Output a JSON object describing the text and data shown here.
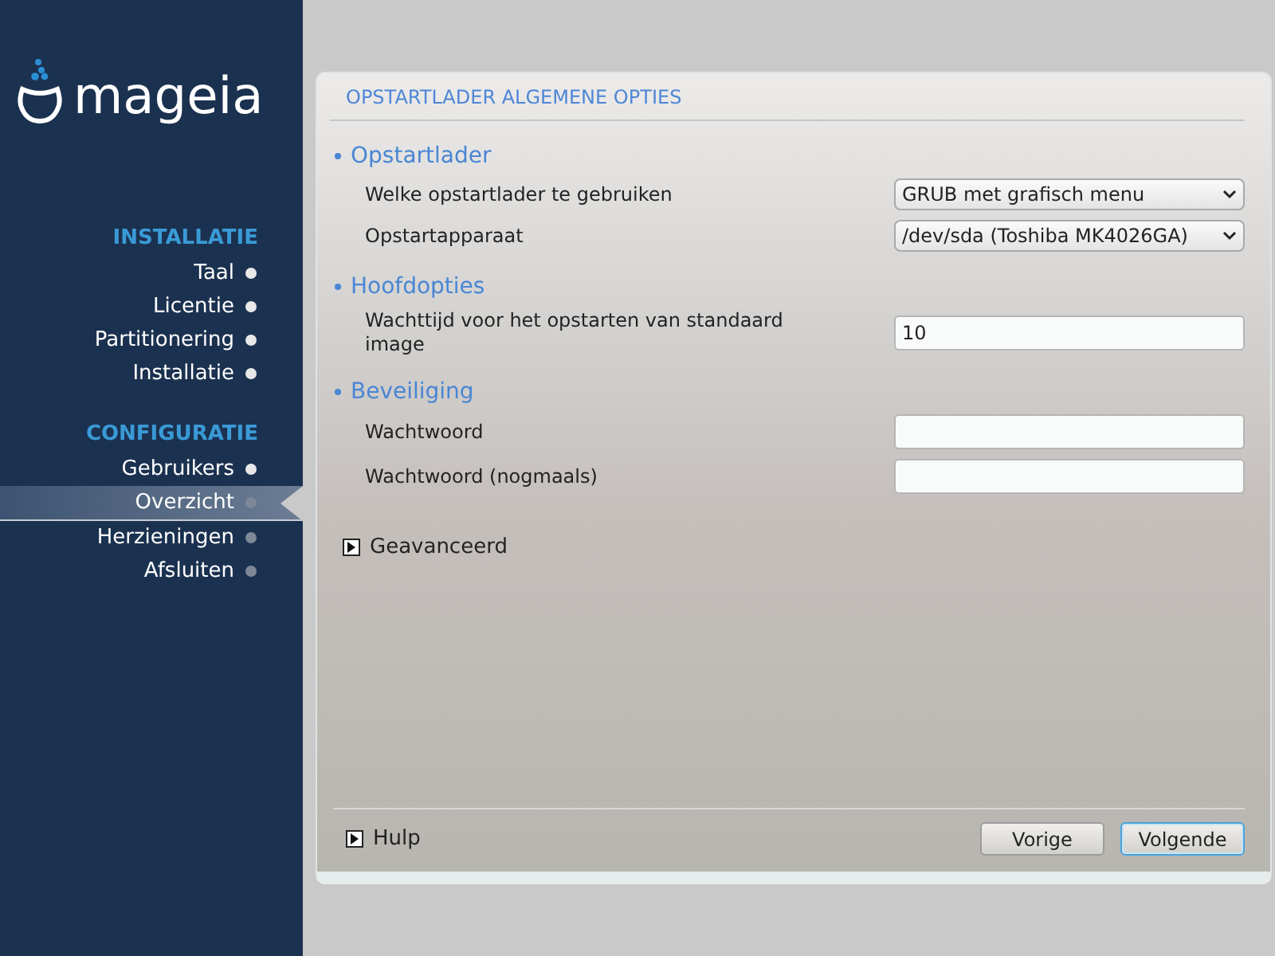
{
  "logo": {
    "text": "mageia"
  },
  "sidebar": {
    "sections": [
      {
        "title": "INSTALLATIE",
        "items": [
          {
            "label": "Taal",
            "done": true,
            "selected": false
          },
          {
            "label": "Licentie",
            "done": true,
            "selected": false
          },
          {
            "label": "Partitionering",
            "done": true,
            "selected": false
          },
          {
            "label": "Installatie",
            "done": true,
            "selected": false
          }
        ]
      },
      {
        "title": "CONFIGURATIE",
        "items": [
          {
            "label": "Gebruikers",
            "done": true,
            "selected": false
          },
          {
            "label": "Overzicht",
            "done": false,
            "selected": true
          },
          {
            "label": "Herzieningen",
            "done": false,
            "selected": false
          },
          {
            "label": "Afsluiten",
            "done": false,
            "selected": false
          }
        ]
      }
    ]
  },
  "panel": {
    "title": "OPSTARTLADER ALGEMENE OPTIES",
    "groups": [
      {
        "title": "Opstartlader",
        "rows": [
          {
            "label": "Welke opstartlader te gebruiken",
            "kind": "dropdown",
            "value": "GRUB met grafisch menu"
          },
          {
            "label": "Opstartapparaat",
            "kind": "dropdown",
            "value": "/dev/sda (Toshiba MK4026GA)"
          }
        ]
      },
      {
        "title": "Hoofdopties",
        "rows": [
          {
            "label": "Wachttijd voor het opstarten van standaard image",
            "kind": "text",
            "value": "10"
          }
        ]
      },
      {
        "title": "Beveiliging",
        "rows": [
          {
            "label": "Wachtwoord",
            "kind": "text"
          },
          {
            "label": "Wachtwoord (nogmaals)",
            "kind": "text"
          }
        ]
      }
    ],
    "advanced": {
      "label": "Geavanceerd"
    },
    "help": {
      "label": "Hulp"
    },
    "buttons": [
      {
        "label": "Vorige",
        "default": false
      },
      {
        "label": "Volgende",
        "default": true
      }
    ]
  }
}
